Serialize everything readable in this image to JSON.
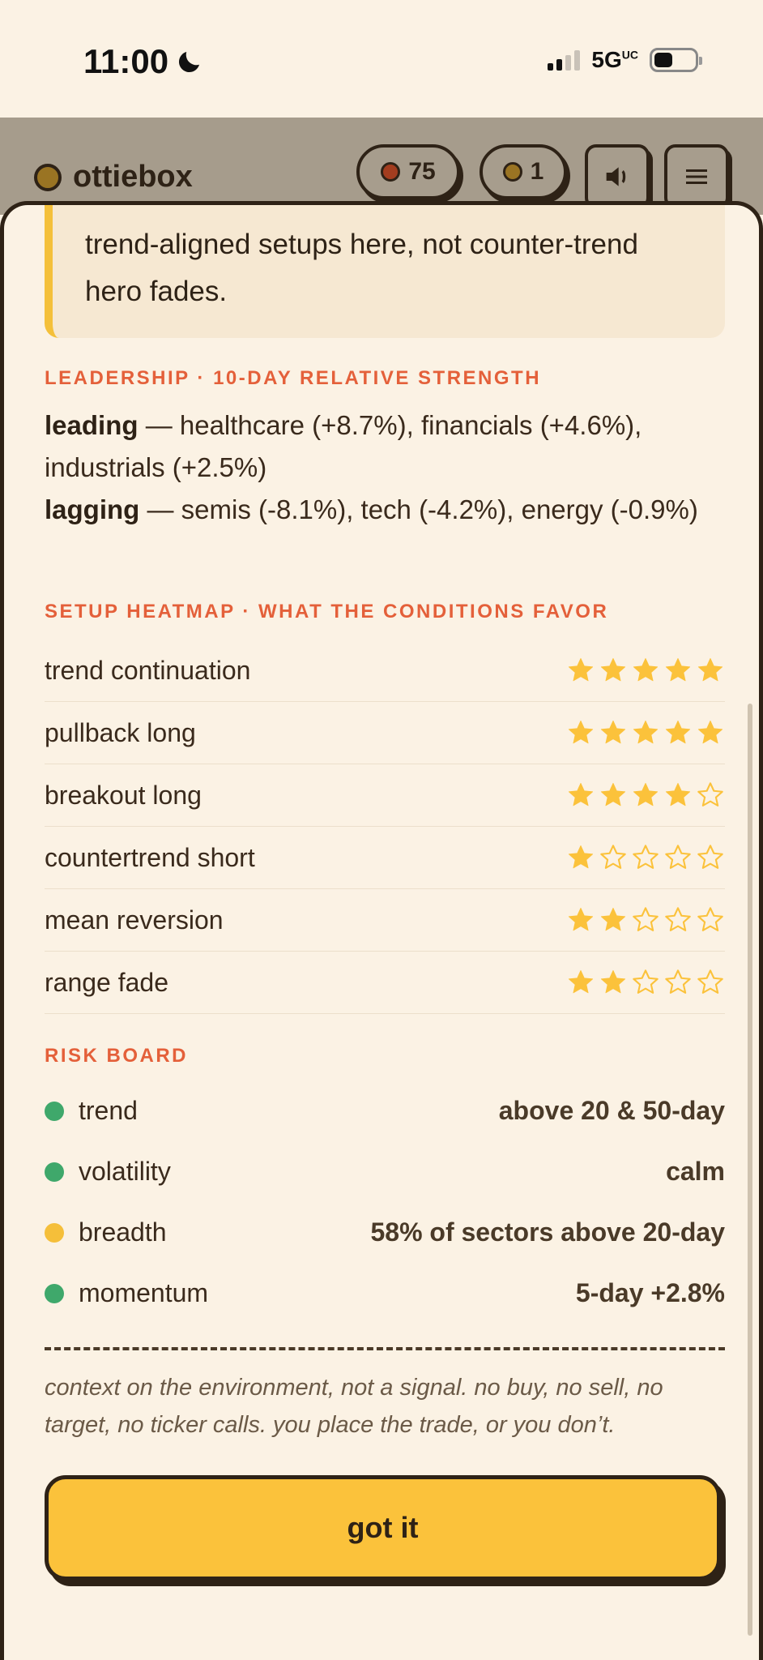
{
  "status_bar": {
    "time": "11:00",
    "network": "5G",
    "network_sup": "UC"
  },
  "header": {
    "brand": "ottiebox",
    "counter_red": "75",
    "counter_gold": "1",
    "colors": {
      "red_dot": "#a33d1f",
      "gold_dot": "#9a7423"
    }
  },
  "callout": {
    "text": "trend-aligned setups here, not counter-trend hero fades."
  },
  "leadership": {
    "heading": "LEADERSHIP · 10-DAY RELATIVE STRENGTH",
    "leading_label": "leading",
    "leading_text": " — healthcare (+8.7%), financials (+4.6%), industrials (+2.5%)",
    "lagging_label": "lagging",
    "lagging_text": " — semis (-8.1%), tech (-4.2%), energy (-0.9%)"
  },
  "heatmap": {
    "heading": "SETUP HEATMAP · WHAT THE CONDITIONS FAVOR",
    "max_stars": 5,
    "rows": [
      {
        "label": "trend continuation",
        "stars": 5
      },
      {
        "label": "pullback long",
        "stars": 5
      },
      {
        "label": "breakout long",
        "stars": 4
      },
      {
        "label": "countertrend short",
        "stars": 1
      },
      {
        "label": "mean reversion",
        "stars": 2
      },
      {
        "label": "range fade",
        "stars": 2
      }
    ]
  },
  "risk_board": {
    "heading": "RISK BOARD",
    "rows": [
      {
        "label": "trend",
        "value": "above 20 & 50-day",
        "status_color": "#3fa86b"
      },
      {
        "label": "volatility",
        "value": "calm",
        "status_color": "#3fa86b"
      },
      {
        "label": "breadth",
        "value": "58% of sectors above 20-day",
        "status_color": "#f5bf3a"
      },
      {
        "label": "momentum",
        "value": "5-day +2.8%",
        "status_color": "#3fa86b"
      }
    ]
  },
  "disclaimer": "context on the environment, not a signal. no buy, no sell, no target, no ticker calls. you place the trade, or you don’t.",
  "primary_button": {
    "label": "got it"
  },
  "colors": {
    "background": "#fbf2e4",
    "accent_heading": "#e4603a",
    "star_gold": "#fbc23b",
    "button_fill": "#fbc23b",
    "outline": "#2e2216"
  }
}
